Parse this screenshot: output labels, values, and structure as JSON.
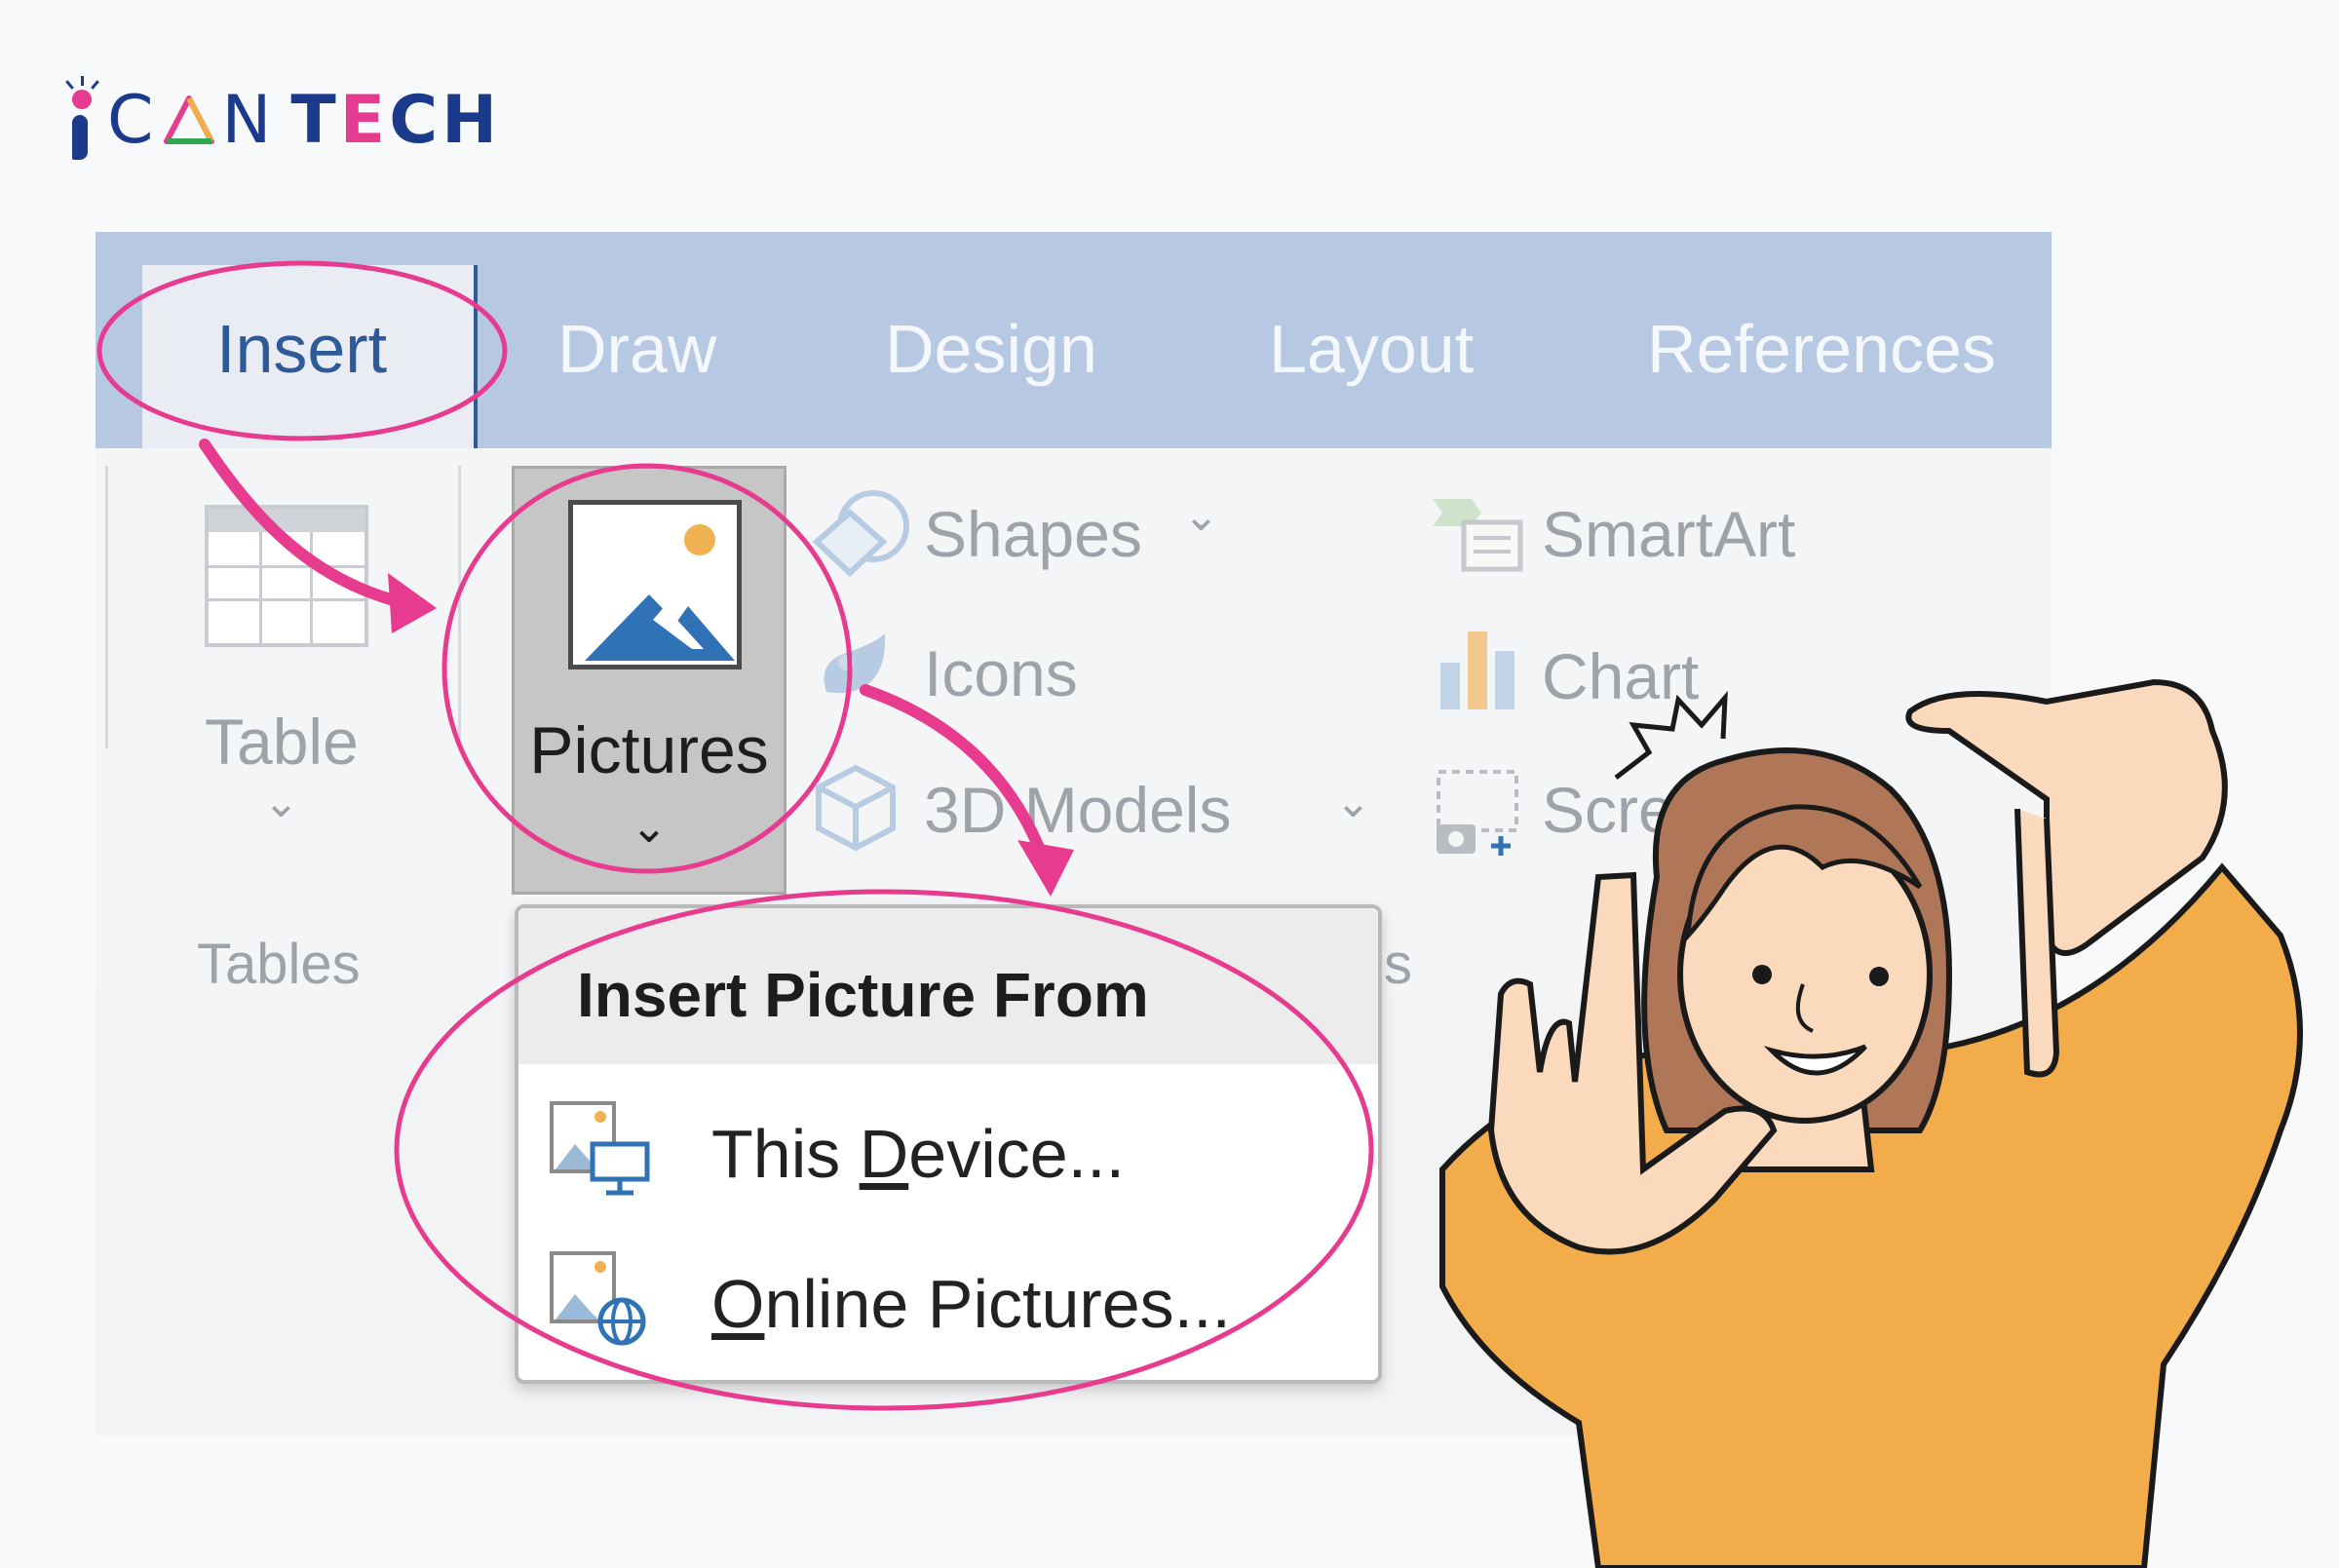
{
  "logo": {
    "c": "C",
    "a": "A",
    "n": "N",
    "tech_t": "T",
    "tech_e": "E",
    "tech_ch": "CH"
  },
  "tabs": [
    {
      "label": "Insert",
      "active": true
    },
    {
      "label": "Draw"
    },
    {
      "label": "Design"
    },
    {
      "label": "Layout"
    },
    {
      "label": "References"
    }
  ],
  "ribbon": {
    "table_label": "Table",
    "tables_group": "Tables",
    "pictures_label": "Pictures",
    "shapes_label": "Shapes",
    "icons_label": "Icons",
    "models_label": "3D Models",
    "smartart_label": "SmartArt",
    "chart_label": "Chart",
    "screenshot_label": "Scre",
    "hidden_group_fragment": "s",
    "chevron": "⌄"
  },
  "dropdown": {
    "title": "Insert Picture From",
    "this_device": {
      "underlined": "D",
      "rest": "evice...",
      "prefix": "This "
    },
    "online": {
      "underlined": "O",
      "rest": "nline Pictures..."
    }
  },
  "colors": {
    "accent": "#e63b8f",
    "tabbar": "#b7c9e2",
    "active_tab_text": "#2f5a98",
    "person_shirt": "#f3ac4a",
    "person_hair": "#b07658",
    "skin": "#fbd9bd"
  }
}
